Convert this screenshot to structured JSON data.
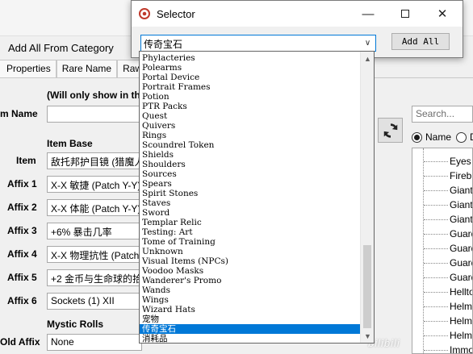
{
  "editor": {
    "add_all_from_category": "Add All From Category",
    "tabs": [
      "Properties",
      "Rare Name",
      "Raw"
    ],
    "note": "(Will only show in the",
    "item_name_label": "m Name",
    "item_base_heading": "Item Base",
    "item_label": "Item",
    "item_value": "敌托邦护目镜 (猎魔人",
    "affixes": [
      {
        "label": "Affix 1",
        "value": "X-X 敏捷 (Patch Y-Y)"
      },
      {
        "label": "Affix 2",
        "value": "X-X 体能 (Patch Y-Y)"
      },
      {
        "label": "Affix 3",
        "value": "+6% 暴击几率"
      },
      {
        "label": "Affix 4",
        "value": "X-X 物理抗性 (Patch"
      },
      {
        "label": "Affix 5",
        "value": "+2 金币与生命球的拾"
      },
      {
        "label": "Affix 6",
        "value": "Sockets (1) XII"
      }
    ],
    "mystic_rolls_heading": "Mystic Rolls",
    "old_affix_label": "Old Affix",
    "old_affix_value": "None"
  },
  "right_panel": {
    "search_placeholder": "Search...",
    "radio_name_label": "Name",
    "radio_other_label": "D",
    "tree_items": [
      "Eyes o",
      "Firebi",
      "Giant",
      "Giant",
      "Giant",
      "Guard",
      "Guard",
      "Guard",
      "Guard",
      "Hellto",
      "Helm",
      "Helm",
      "Helm",
      "Immo"
    ]
  },
  "selector": {
    "title": "Selector",
    "combo_value": "传奇宝石",
    "add_all_label": "Add All",
    "options": [
      "Phylacteries",
      "Polearms",
      "Portal Device",
      "Portrait Frames",
      "Potion",
      "PTR Packs",
      "Quest",
      "Quivers",
      "Rings",
      "Scoundrel Token",
      "Shields",
      "Shoulders",
      "Sources",
      "Spears",
      "Spirit Stones",
      "Staves",
      "Sword",
      "Templar Relic",
      "Testing: Art",
      "Tome of Training",
      "Unknown",
      "Visual Items (NPCs)",
      "Voodoo Masks",
      "Wanderer's Promo",
      "Wands",
      "Wings",
      "Wizard Hats",
      "宠物",
      "传奇宝石",
      "消耗品"
    ],
    "selected_option": "传奇宝石"
  },
  "watermark": "bilibili",
  "colors": {
    "selection": "#0078d7",
    "combo_border": "#0078d7",
    "window_bg": "#f0f0f0"
  }
}
